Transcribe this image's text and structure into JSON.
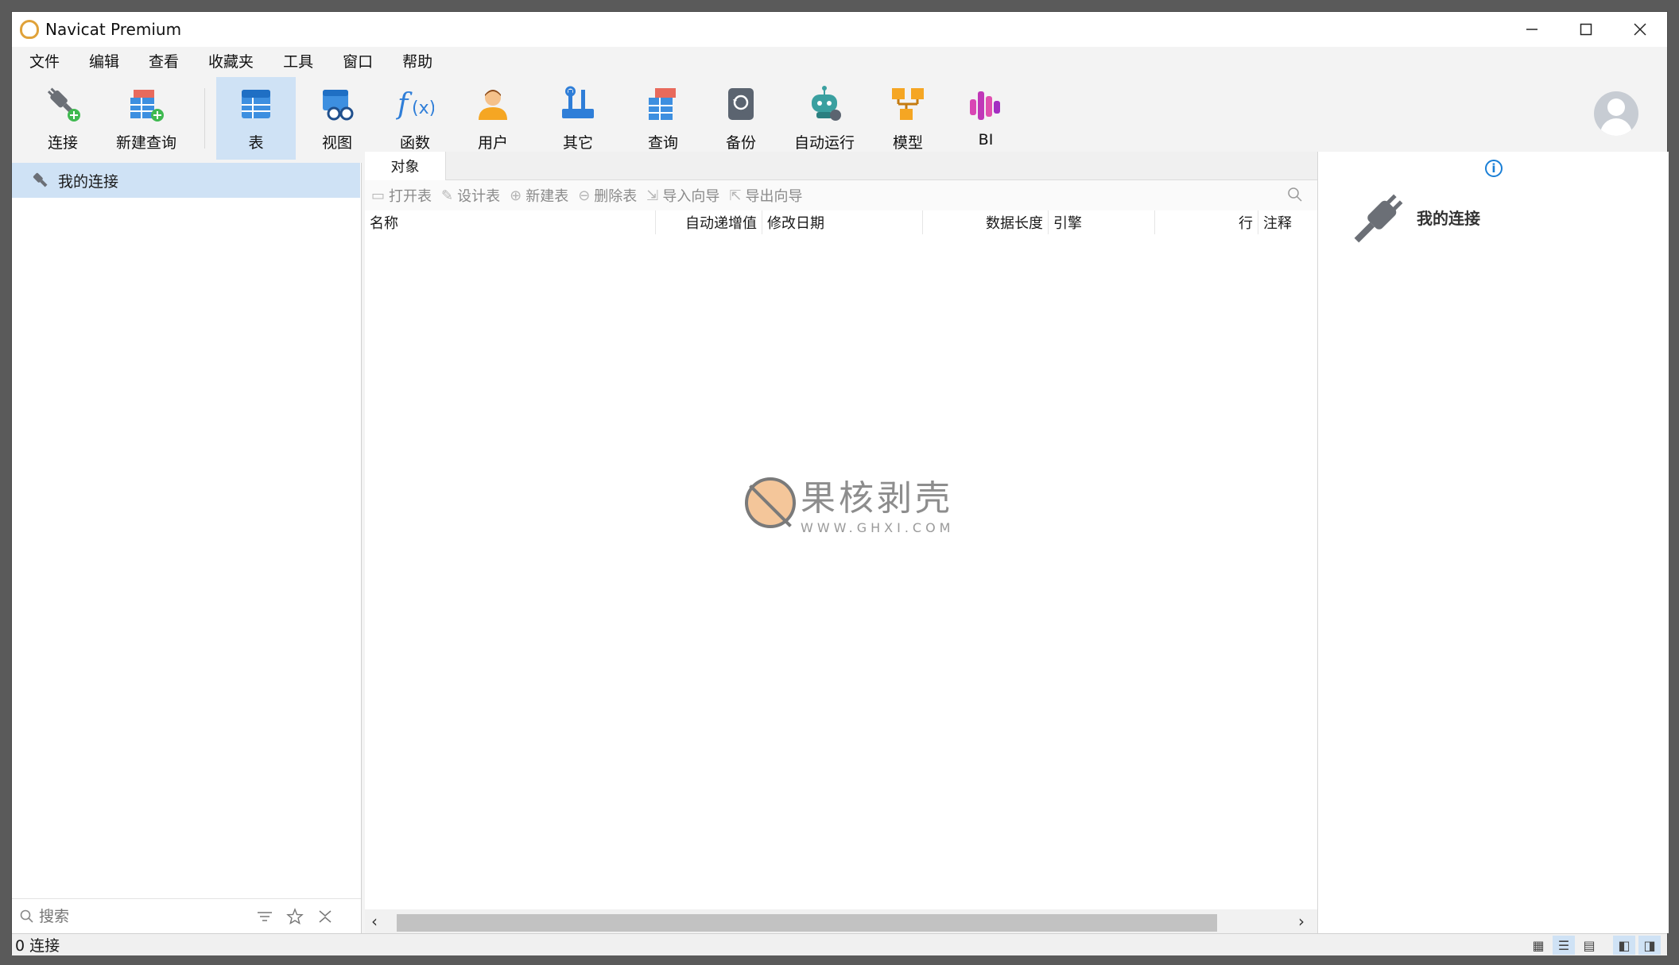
{
  "window": {
    "title": "Navicat Premium"
  },
  "menu": [
    "文件",
    "编辑",
    "查看",
    "收藏夹",
    "工具",
    "窗口",
    "帮助"
  ],
  "toolbar": {
    "connect": "连接",
    "new_query": "新建查询",
    "table": "表",
    "view": "视图",
    "function": "函数",
    "user": "用户",
    "other": "其它",
    "query": "查询",
    "backup": "备份",
    "automation": "自动运行",
    "model": "模型",
    "bi": "BI"
  },
  "sidebar": {
    "connection": "我的连接",
    "search_placeholder": "搜索"
  },
  "objects": {
    "tab": "对象",
    "actions": {
      "open": "打开表",
      "design": "设计表",
      "new": "新建表",
      "delete": "删除表",
      "import": "导入向导",
      "export": "导出向导"
    },
    "columns": {
      "name": "名称",
      "auto_inc": "自动递增值",
      "modified": "修改日期",
      "data_length": "数据长度",
      "engine": "引擎",
      "rows": "行",
      "comment": "注释"
    }
  },
  "watermark": {
    "text": "果核剥壳",
    "url": "WWW.GHXI.COM"
  },
  "info": {
    "title": "我的连接"
  },
  "status": {
    "text": "0 连接"
  }
}
